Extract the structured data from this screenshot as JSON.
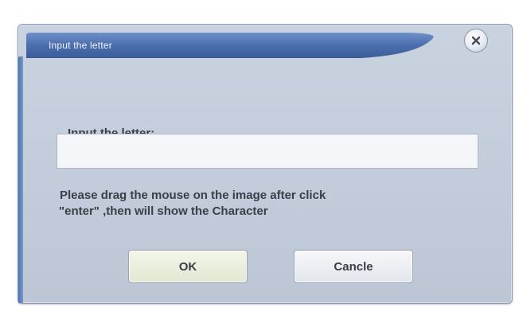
{
  "dialog": {
    "title": "Input the letter",
    "prompt_label": "Input the letter:",
    "input_value": "",
    "hint_line1": "Please drag the mouse on the image after click",
    "hint_line2": "\"enter\" ,then will show the Character",
    "ok_label": "OK",
    "cancel_label": "Cancle"
  },
  "icons": {
    "close": "close-icon"
  },
  "colors": {
    "title_bar": "#4b6fae",
    "dialog_body": "#c4cedb",
    "ok_button": "#e6ecd6",
    "cancel_button": "#e8ebf0"
  }
}
